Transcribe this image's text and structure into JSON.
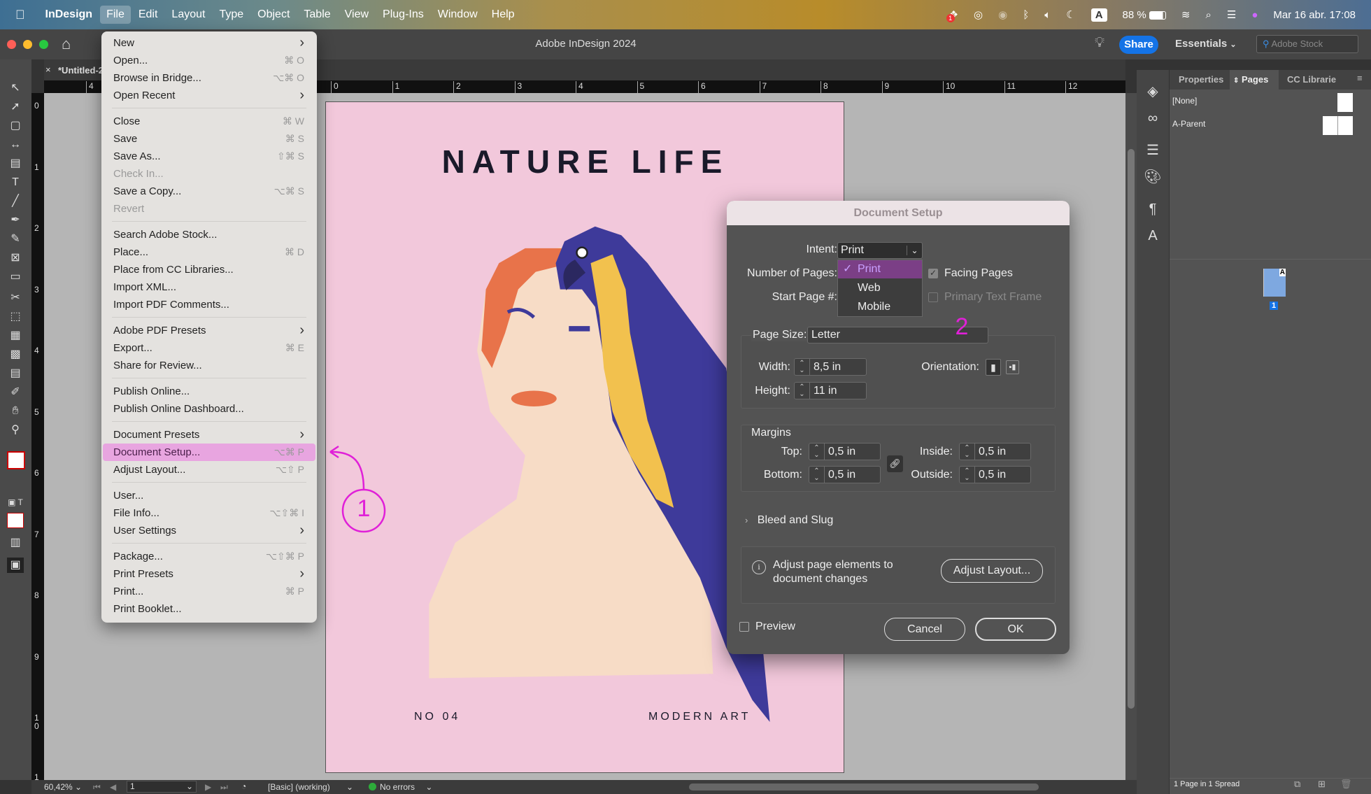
{
  "menubar": {
    "app": "InDesign",
    "items": [
      "File",
      "Edit",
      "Layout",
      "Type",
      "Object",
      "Table",
      "View",
      "Plug-Ins",
      "Window",
      "Help"
    ],
    "active": "File",
    "battery": "88 %",
    "keyboard": "A",
    "datetime": "Mar 16 abr.  17:08",
    "notification_badge": "1"
  },
  "window": {
    "title": "Adobe InDesign 2024",
    "share_label": "Share",
    "workspace": "Essentials",
    "stock_placeholder": "Adobe Stock",
    "share_color": "#1473e6"
  },
  "tab": {
    "label": "*Untitled-2"
  },
  "rulers": {
    "horizontal": [
      "4",
      "0",
      "1",
      "2",
      "3",
      "4",
      "5",
      "6",
      "7",
      "8",
      "9",
      "10",
      "11",
      "12",
      "1"
    ],
    "vertical": [
      "0",
      "1",
      "2",
      "3",
      "4",
      "5",
      "6",
      "7",
      "8",
      "9",
      "10",
      "1"
    ]
  },
  "file_menu": [
    {
      "label": "New",
      "shortcut": "",
      "submenu": true
    },
    {
      "label": "Open...",
      "shortcut": "⌘ O"
    },
    {
      "label": "Browse in Bridge...",
      "shortcut": "⌥⌘ O"
    },
    {
      "label": "Open Recent",
      "shortcut": "",
      "submenu": true,
      "sep": true
    },
    {
      "label": "Close",
      "shortcut": "⌘ W"
    },
    {
      "label": "Save",
      "shortcut": "⌘ S"
    },
    {
      "label": "Save As...",
      "shortcut": "⇧⌘ S"
    },
    {
      "label": "Check In...",
      "shortcut": "",
      "disabled": true
    },
    {
      "label": "Save a Copy...",
      "shortcut": "⌥⌘ S"
    },
    {
      "label": "Revert",
      "shortcut": "",
      "disabled": true,
      "sep": true
    },
    {
      "label": "Search Adobe Stock...",
      "shortcut": ""
    },
    {
      "label": "Place...",
      "shortcut": "⌘ D"
    },
    {
      "label": "Place from CC Libraries...",
      "shortcut": ""
    },
    {
      "label": "Import XML...",
      "shortcut": ""
    },
    {
      "label": "Import PDF Comments...",
      "shortcut": "",
      "sep": true
    },
    {
      "label": "Adobe PDF Presets",
      "shortcut": "",
      "submenu": true
    },
    {
      "label": "Export...",
      "shortcut": "⌘ E"
    },
    {
      "label": "Share for Review...",
      "shortcut": "",
      "sep": true
    },
    {
      "label": "Publish Online...",
      "shortcut": ""
    },
    {
      "label": "Publish Online Dashboard...",
      "shortcut": "",
      "sep": true
    },
    {
      "label": "Document Presets",
      "shortcut": "",
      "submenu": true
    },
    {
      "label": "Document Setup...",
      "shortcut": "⌥⌘ P",
      "highlighted": true
    },
    {
      "label": "Adjust Layout...",
      "shortcut": "⌥⇧ P",
      "sep": true
    },
    {
      "label": "User...",
      "shortcut": ""
    },
    {
      "label": "File Info...",
      "shortcut": "⌥⇧⌘ I"
    },
    {
      "label": "User Settings",
      "shortcut": "",
      "submenu": true,
      "sep": true
    },
    {
      "label": "Package...",
      "shortcut": "⌥⇧⌘ P"
    },
    {
      "label": "Print Presets",
      "shortcut": "",
      "submenu": true
    },
    {
      "label": "Print...",
      "shortcut": "⌘ P"
    },
    {
      "label": "Print Booklet...",
      "shortcut": ""
    }
  ],
  "page_art": {
    "title": "NATURE LIFE",
    "footer_left": "NO 04",
    "footer_right": "MODERN ART",
    "background": "#f2c8db"
  },
  "dialog": {
    "title": "Document Setup",
    "intent_label": "Intent:",
    "intent_value": "Print",
    "intent_options": [
      "Print",
      "Web",
      "Mobile"
    ],
    "num_pages_label": "Number of Pages:",
    "start_page_label": "Start Page #:",
    "facing_pages_label": "Facing Pages",
    "facing_pages_checked": true,
    "primary_text_frame_label": "Primary Text Frame",
    "page_size_label": "Page Size:",
    "page_size_value": "Letter",
    "width_label": "Width:",
    "width_value": "8,5 in",
    "height_label": "Height:",
    "height_value": "11 in",
    "orientation_label": "Orientation:",
    "margins_label": "Margins",
    "top_label": "Top:",
    "top_value": "0,5 in",
    "bottom_label": "Bottom:",
    "bottom_value": "0,5 in",
    "inside_label": "Inside:",
    "inside_value": "0,5 in",
    "outside_label": "Outside:",
    "outside_value": "0,5 in",
    "bleed_label": "Bleed and Slug",
    "info_line1": "Adjust page elements to",
    "info_line2": "document changes",
    "adjust_layout_label": "Adjust Layout...",
    "preview_label": "Preview",
    "cancel_label": "Cancel",
    "ok_label": "OK"
  },
  "annotations": {
    "step1": "1",
    "step2": "2",
    "color": "#e020d8"
  },
  "pages_panel": {
    "tabs": [
      "Properties",
      "Pages",
      "CC Librarie"
    ],
    "active_tab": "Pages",
    "parents": [
      "[None]",
      "A-Parent"
    ],
    "page_number": "1",
    "page_parent_letter": "A",
    "footer": "1 Page in 1 Spread"
  },
  "statusbar": {
    "zoom": "60,42%",
    "page": "1",
    "preflight_profile": "[Basic] (working)",
    "errors": "No errors"
  }
}
